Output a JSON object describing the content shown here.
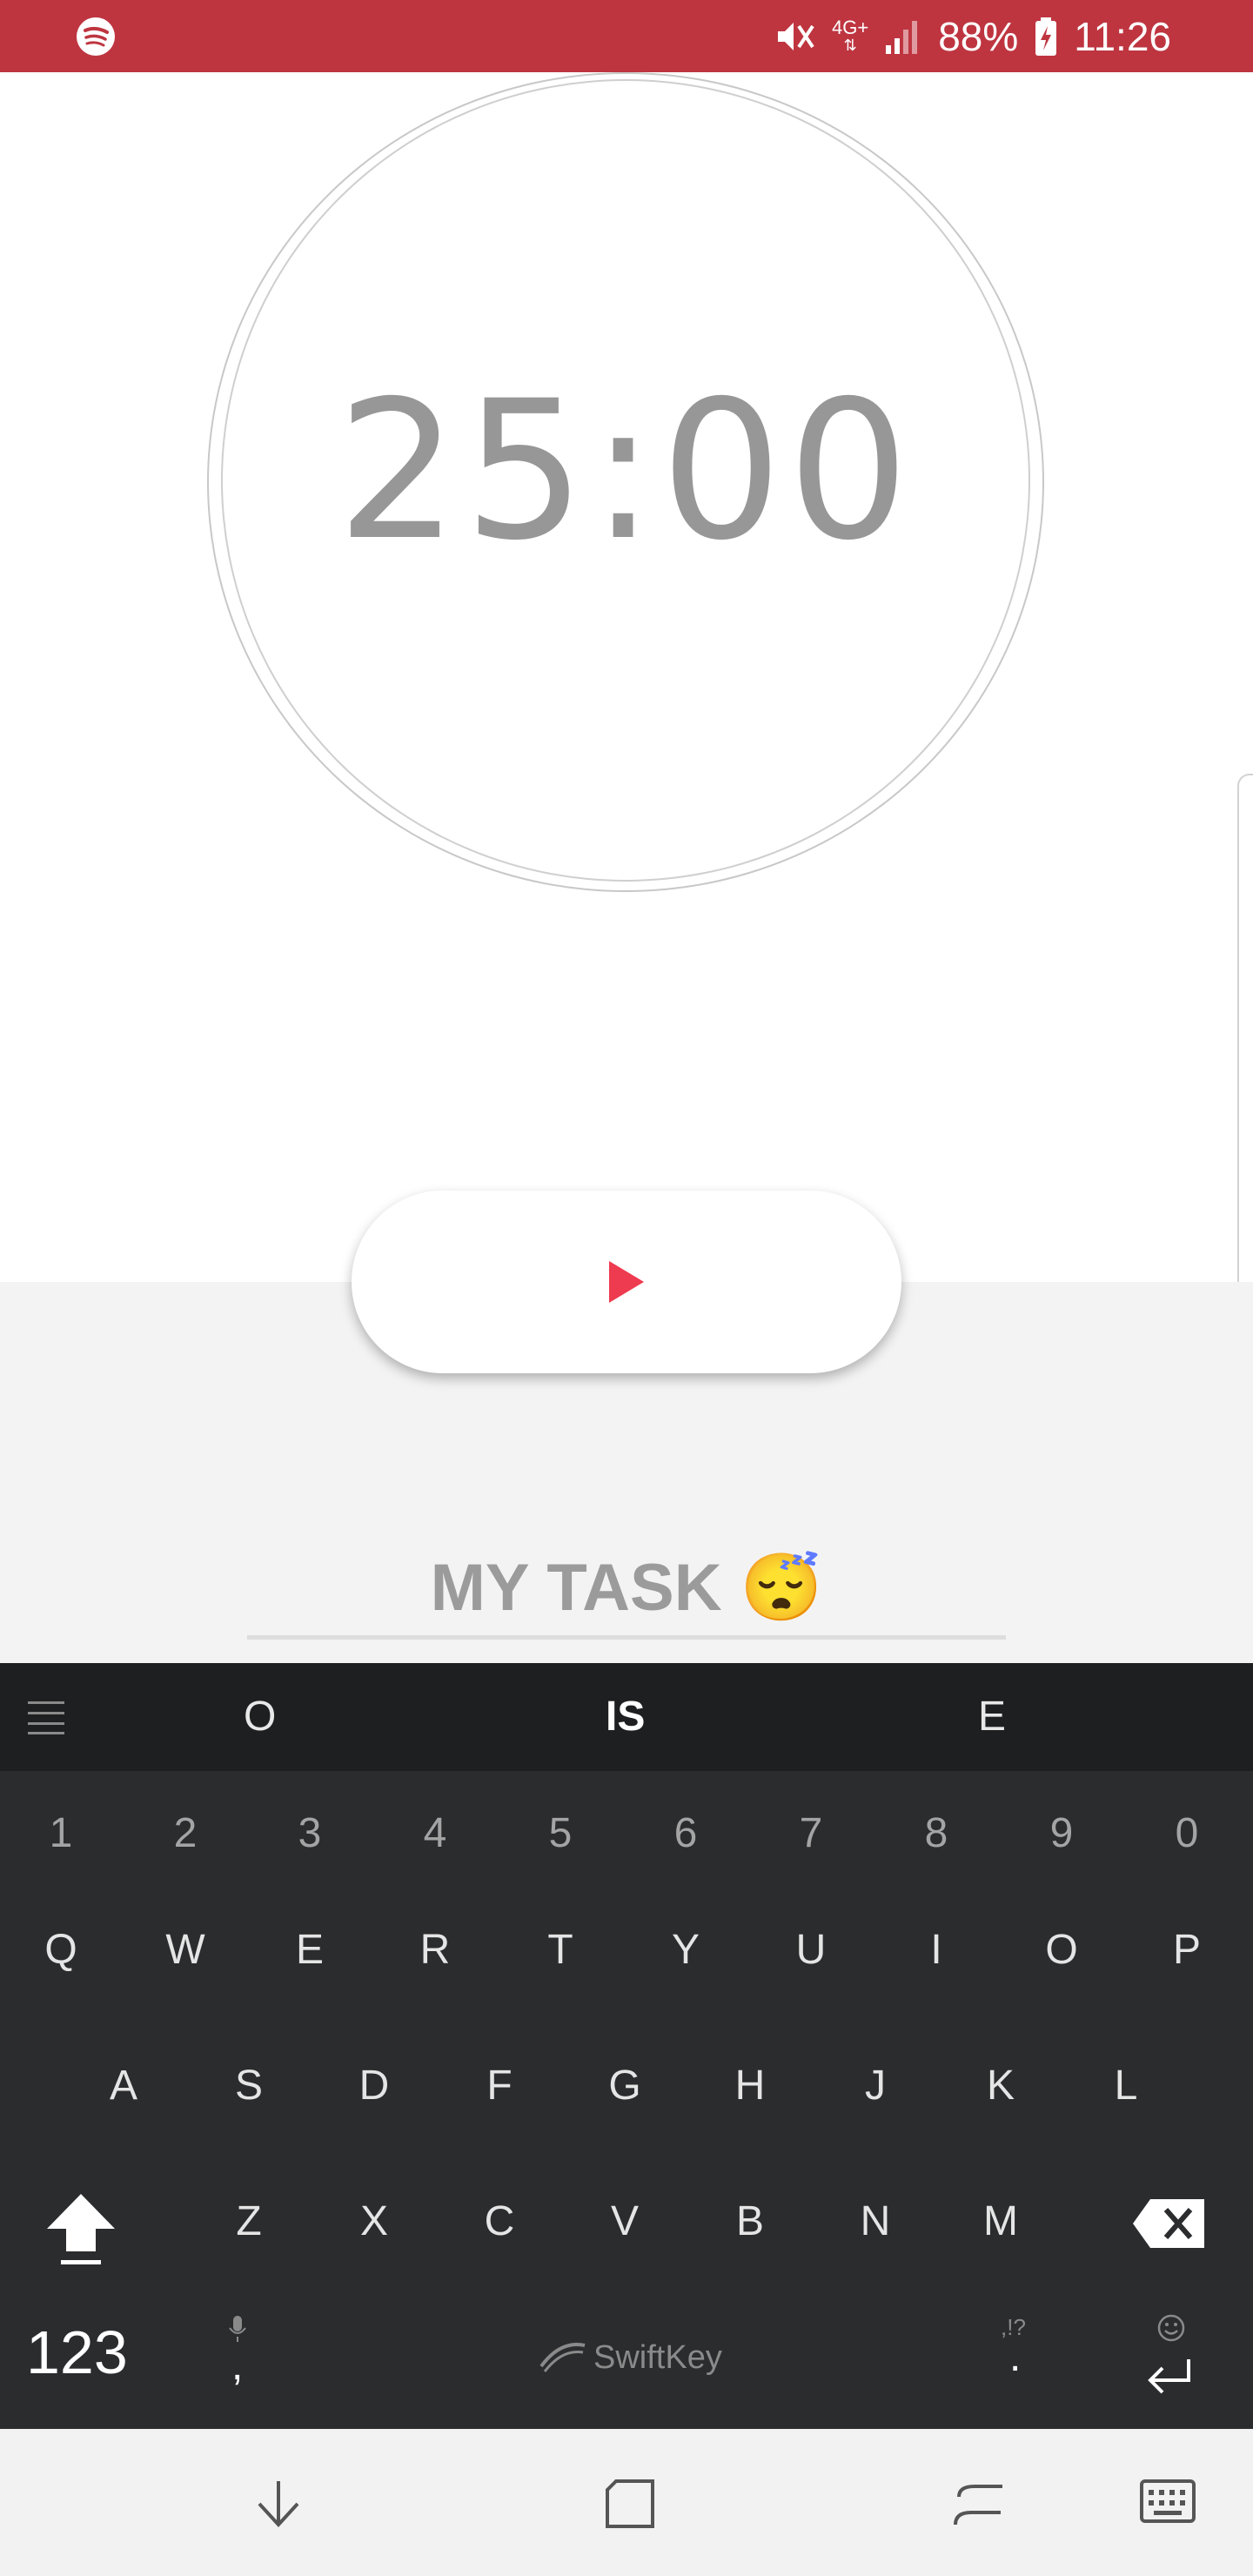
{
  "status_bar": {
    "battery": "88%",
    "time": "11:26",
    "network": "4G+",
    "color": "#be3540"
  },
  "timer": {
    "display": "25:00"
  },
  "task": {
    "label": "MY TASK 😴"
  },
  "keyboard": {
    "suggestions": [
      "O",
      "IS",
      "E"
    ],
    "number_row": [
      "1",
      "2",
      "3",
      "4",
      "5",
      "6",
      "7",
      "8",
      "9",
      "0"
    ],
    "row1": [
      "Q",
      "W",
      "E",
      "R",
      "T",
      "Y",
      "U",
      "I",
      "O",
      "P"
    ],
    "row2": [
      "A",
      "S",
      "D",
      "F",
      "G",
      "H",
      "J",
      "K",
      "L"
    ],
    "row3": [
      "Z",
      "X",
      "C",
      "V",
      "B",
      "N",
      "M"
    ],
    "numbers_key": "123",
    "comma": ",",
    "period": ".",
    "punct_hint": ",!?",
    "brand": "SwiftKey"
  },
  "colors": {
    "play_accent": "#ee3b4f",
    "keyboard_bg": "#2b2c2e"
  }
}
